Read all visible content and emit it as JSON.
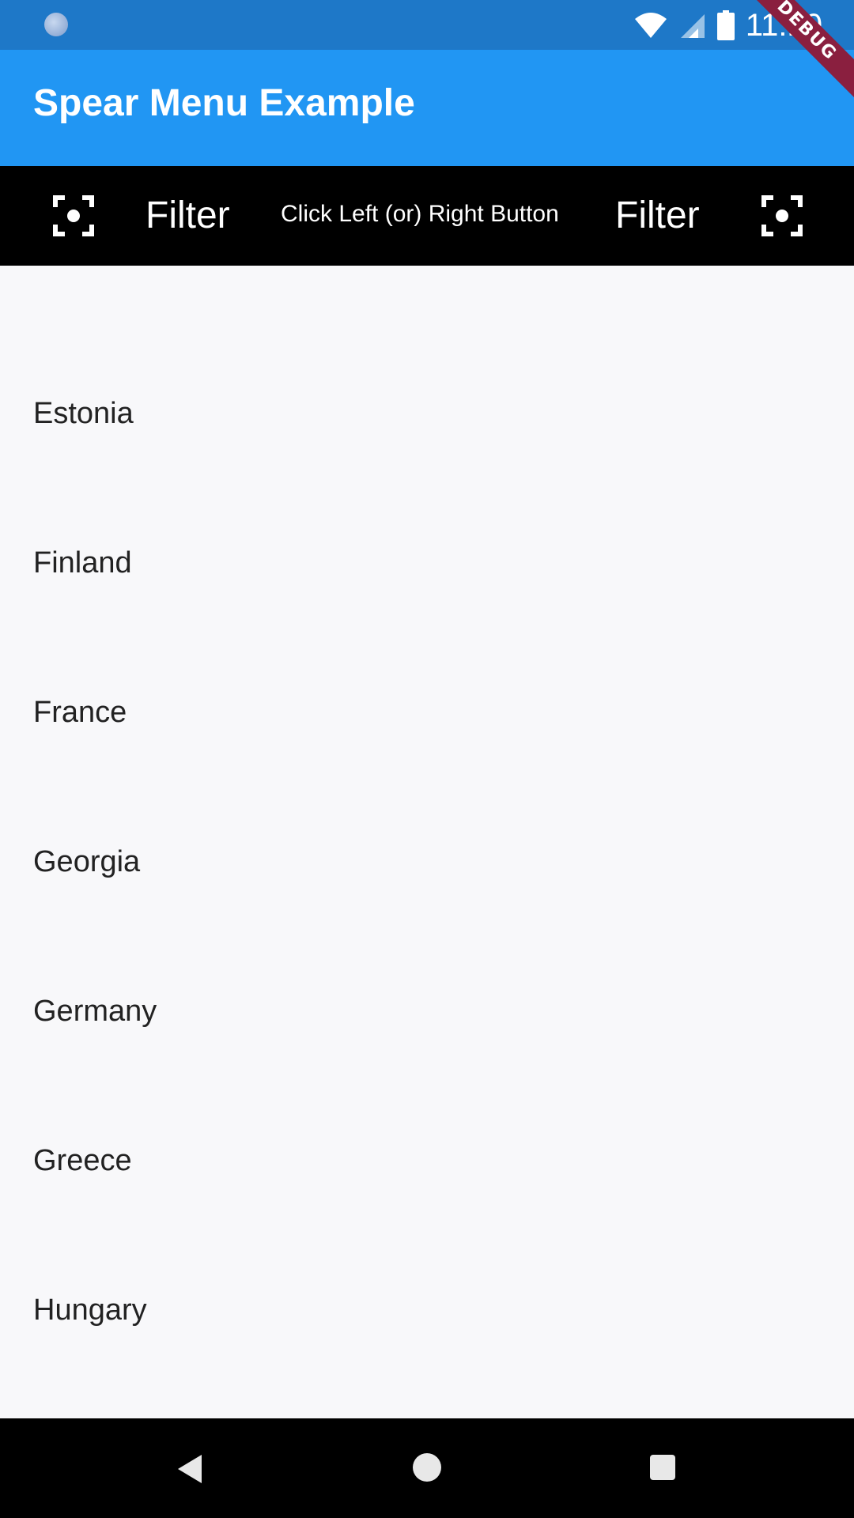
{
  "status_bar": {
    "time": "11:10",
    "icons": [
      "notification-dot-icon",
      "wifi-icon",
      "signal-icon",
      "battery-icon"
    ]
  },
  "app_bar": {
    "title": "Spear Menu Example",
    "debug_banner": "DEBUG"
  },
  "filter_bar": {
    "left_icon": "focus-icon",
    "left_button_label": "Filter",
    "hint": "Click Left (or) Right Button",
    "right_button_label": "Filter",
    "right_icon": "focus-icon"
  },
  "countries": [
    "Estonia",
    "Finland",
    "France",
    "Georgia",
    "Germany",
    "Greece",
    "Hungary"
  ],
  "nav_bar": {
    "icons": [
      "back-icon",
      "home-icon",
      "recents-icon"
    ]
  },
  "colors": {
    "status_bar": "#1e78c8",
    "app_bar": "#2196f3",
    "filter_bar": "#000000",
    "list_background": "#f8f8fa",
    "debug_banner": "#8a1f3f"
  }
}
